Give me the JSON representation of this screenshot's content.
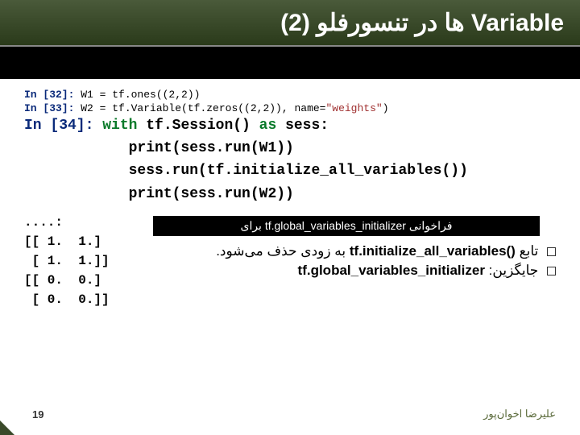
{
  "title": "Variable ها در تنسورفلو (2)",
  "code": {
    "line1_prompt": "In [32]: ",
    "line1_code": "W1 = tf.ones((2,2))",
    "line2_prompt": "In [33]: ",
    "line2_code1": "W2 = tf.Variable(tf.zeros((2,2)), name=",
    "line2_str": "\"weights\"",
    "line2_code2": ")",
    "line3_prompt": "In [34]: ",
    "line3_kw1": "with",
    "line3_mid": " tf.Session() ",
    "line3_kw2": "as",
    "line3_end": " sess:",
    "line4": "            print(sess.run(W1))",
    "line5": "            sess.run(tf.initialize_all_variables())",
    "line6": "            print(sess.run(W2))"
  },
  "output": "....:\n[[ 1.  1.]\n [ 1.  1.]]\n[[ 0.  0.]\n [ 0.  0.]]",
  "blackbox": "فراخوانی tf.global_variables_initializer برای",
  "notes": {
    "n1_pre": "تابع ",
    "n1_code": "tf.initialize_all_variables()",
    "n1_post": " به زودی حذف می‌شود.",
    "n2_pre": "جایگزین: ",
    "n2_code": "tf.global_variables_initializer"
  },
  "page": "19",
  "author": "علیرضا اخوان‌پور"
}
